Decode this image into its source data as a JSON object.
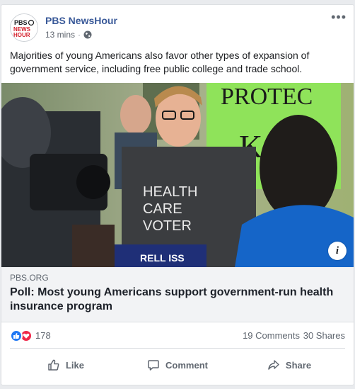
{
  "post": {
    "page_name": "PBS NewsHour",
    "timestamp": "13 mins",
    "separator": "·",
    "privacy_icon": "globe-icon",
    "more_icon": "ellipsis-icon",
    "text": "Majorities of young Americans also favor other types of expansion of government service, including free public college and trade school."
  },
  "logo": {
    "line1": "PBS",
    "line2": "NEWS",
    "line3": "HOUR"
  },
  "photo": {
    "shirt_line1": "HEALTH",
    "shirt_line2": "CARE",
    "shirt_line3": "VOTER",
    "sign_text": "PROTEC",
    "sign_letter": "K",
    "banner_text": "RELL ISS",
    "info_label": "i"
  },
  "link": {
    "domain": "PBS.ORG",
    "headline": "Poll: Most young Americans support government-run health insurance program"
  },
  "stats": {
    "reaction_count": "178",
    "comments": "19 Comments",
    "shares": "30 Shares"
  },
  "actions": {
    "like": "Like",
    "comment": "Comment",
    "share": "Share"
  },
  "colors": {
    "page_link": "#385898",
    "like_blue": "#2078f4",
    "love_red": "#f0284a",
    "pbs_red": "#d4202b"
  }
}
